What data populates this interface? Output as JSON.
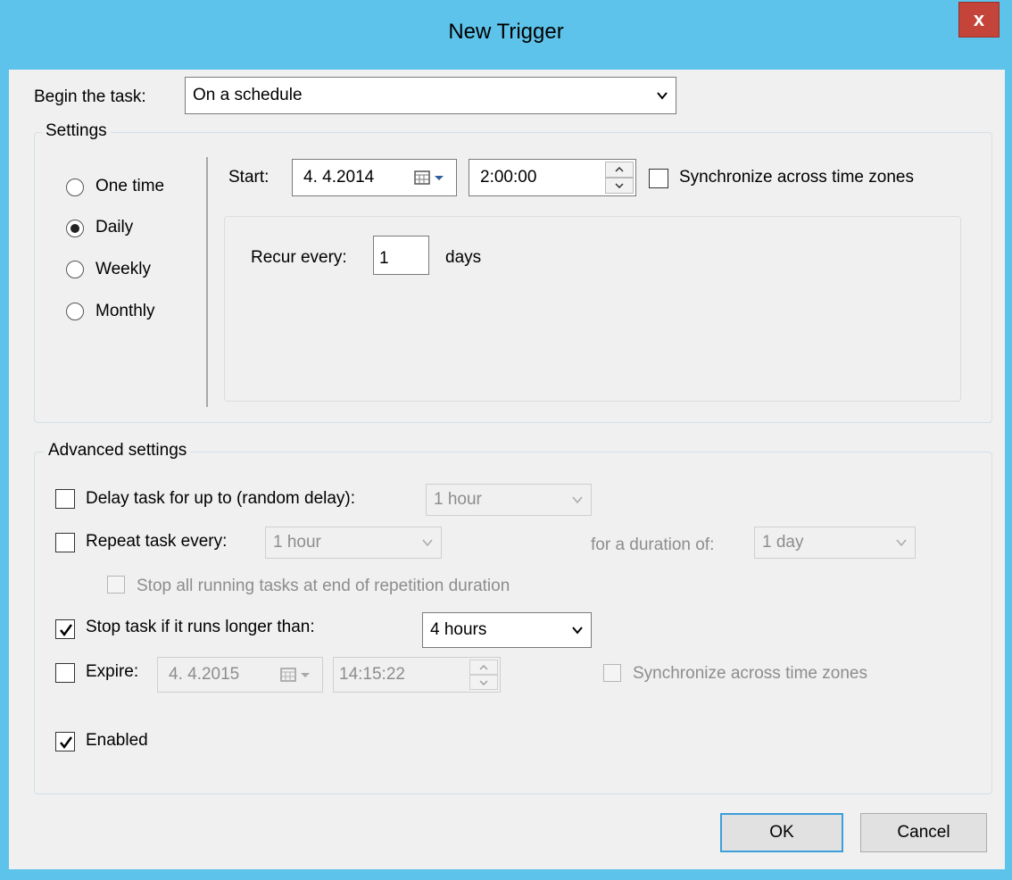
{
  "window": {
    "title": "New Trigger",
    "close_label": "x"
  },
  "begin": {
    "label": "Begin the task:",
    "value": "On a schedule"
  },
  "settings": {
    "group_title": "Settings",
    "radios": [
      {
        "label": "One time",
        "checked": false
      },
      {
        "label": "Daily",
        "checked": true
      },
      {
        "label": "Weekly",
        "checked": false
      },
      {
        "label": "Monthly",
        "checked": false
      }
    ],
    "start_label": "Start:",
    "start_date": "4.  4.2014",
    "start_time": "2:00:00",
    "sync_label": "Synchronize across time zones",
    "recur_label": "Recur every:",
    "recur_value": "1",
    "recur_unit": "days"
  },
  "advanced": {
    "group_title": "Advanced settings",
    "delay_label": "Delay task for up to (random delay):",
    "delay_value": "1 hour",
    "repeat_label": "Repeat task every:",
    "repeat_value": "1 hour",
    "duration_label": "for a duration of:",
    "duration_value": "1 day",
    "stop_all_label": "Stop all running tasks at end of repetition duration",
    "stop_if_label": "Stop task if it runs longer than:",
    "stop_if_value": "4 hours",
    "expire_label": "Expire:",
    "expire_date": "4.  4.2015",
    "expire_time": "14:15:22",
    "expire_sync_label": "Synchronize across time zones",
    "enabled_label": "Enabled"
  },
  "buttons": {
    "ok": "OK",
    "cancel": "Cancel"
  },
  "colors": {
    "titlebar": "#5ec3ea",
    "close": "#c4443a",
    "client": "#f0f0f0",
    "default_button_border": "#3c9fd8"
  }
}
